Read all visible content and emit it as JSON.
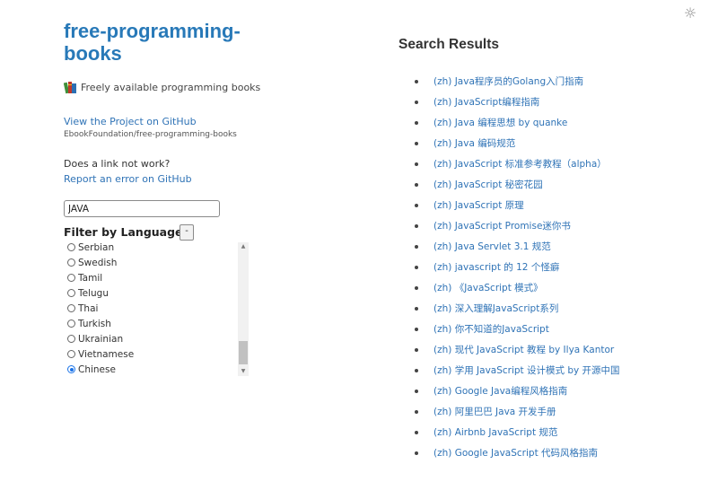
{
  "header": {
    "title": "free-programming-books",
    "tagline": "Freely available programming books"
  },
  "project": {
    "link_label": "View the Project on GitHub",
    "repo": "EbookFoundation/free-programming-books"
  },
  "report": {
    "question": "Does a link not work?",
    "link_label": "Report an error on GitHub"
  },
  "search": {
    "value": "JAVA"
  },
  "filter": {
    "title": "Filter by Language",
    "toggle_label": "-",
    "languages": [
      {
        "label": "Serbian",
        "selected": false
      },
      {
        "label": "Swedish",
        "selected": false
      },
      {
        "label": "Tamil",
        "selected": false
      },
      {
        "label": "Telugu",
        "selected": false
      },
      {
        "label": "Thai",
        "selected": false
      },
      {
        "label": "Turkish",
        "selected": false
      },
      {
        "label": "Ukrainian",
        "selected": false
      },
      {
        "label": "Vietnamese",
        "selected": false
      },
      {
        "label": "Chinese",
        "selected": true
      }
    ]
  },
  "results": {
    "title": "Search Results",
    "items": [
      "(zh) Java程序员的Golang入门指南",
      "(zh) JavaScript编程指南",
      "(zh) Java 编程思想 by quanke",
      "(zh) Java 编码规范",
      "(zh) JavaScript 标准参考教程（alpha）",
      "(zh) JavaScript 秘密花园",
      "(zh) JavaScript 原理",
      "(zh) JavaScript Promise迷你书",
      "(zh) Java Servlet 3.1 规范",
      "(zh) javascript 的 12 个怪癖",
      "(zh) 《JavaScript 模式》",
      "(zh) 深入理解JavaScript系列",
      "(zh) 你不知道的JavaScript",
      "(zh) 现代 JavaScript 教程 by Ilya Kantor",
      "(zh) 学用 JavaScript 设计模式 by 开源中国",
      "(zh) Google Java编程风格指南",
      "(zh) 阿里巴巴 Java 开发手册",
      "(zh) Airbnb JavaScript 规范",
      "(zh) Google JavaScript 代码风格指南"
    ]
  },
  "icons": {
    "theme_toggle": "sun-icon",
    "logo": "books-icon"
  }
}
